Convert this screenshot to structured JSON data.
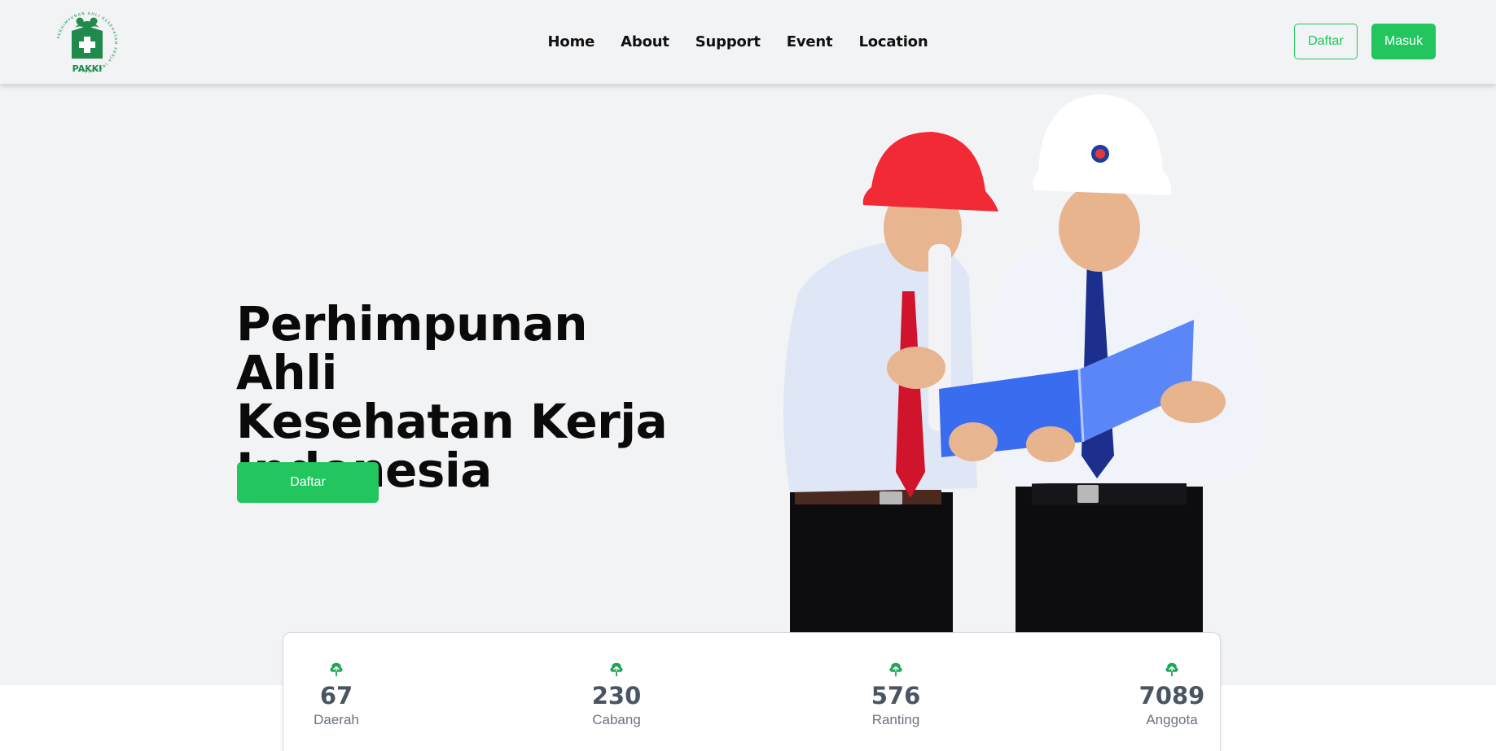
{
  "brand": {
    "logo_text": "PAKKI",
    "logo_ring_text": "PERHIMPUNAN AHLI KESEHATAN KERJA INDONESIA",
    "accent_color": "#22c55e"
  },
  "nav": {
    "links": [
      "Home",
      "About",
      "Support",
      "Event",
      "Location"
    ]
  },
  "auth": {
    "register_label": "Daftar",
    "login_label": "Masuk"
  },
  "hero": {
    "title_lines": [
      "Perhimpunan Ahli",
      "Kesehatan Kerja",
      "Indonesia"
    ],
    "cta_label": "Daftar"
  },
  "stats": [
    {
      "value": "67",
      "label": "Daerah",
      "icon": "tree-icon"
    },
    {
      "value": "230",
      "label": "Cabang",
      "icon": "tree-icon"
    },
    {
      "value": "576",
      "label": "Ranting",
      "icon": "tree-icon"
    },
    {
      "value": "7089",
      "label": "Anggota",
      "icon": "tree-icon"
    }
  ]
}
